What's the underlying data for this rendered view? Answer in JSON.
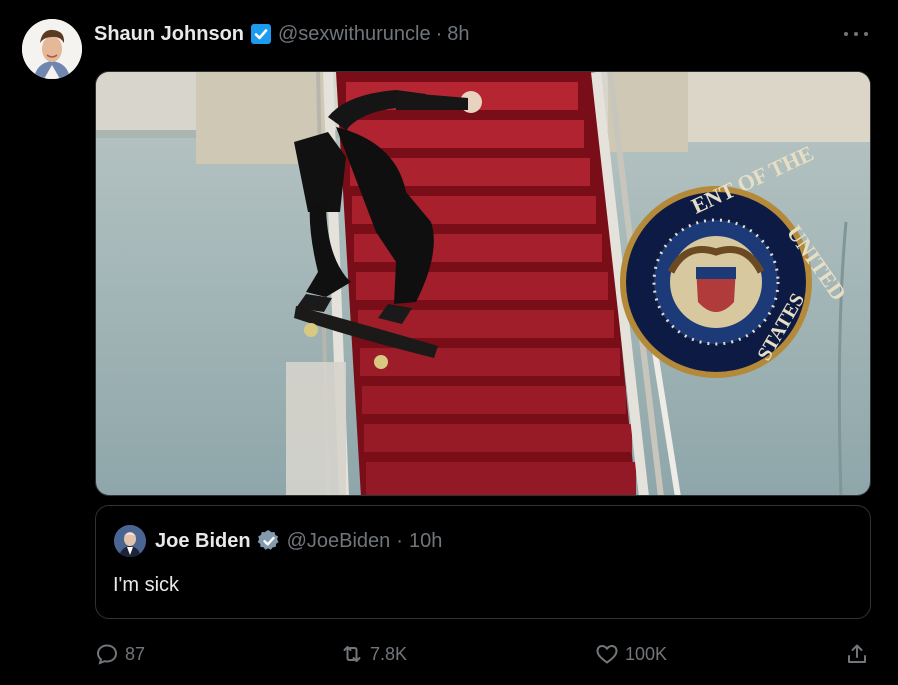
{
  "tweet": {
    "author_name": "Shaun Johnson",
    "handle": "@sexwithuruncle",
    "separator": "·",
    "time": "8h",
    "media": {
      "seal_text": "ENT OF THE UNITED STATES"
    }
  },
  "quoted": {
    "author_name": "Joe Biden",
    "handle": "@JoeBiden",
    "separator": "·",
    "time": "10h",
    "text": "I'm sick"
  },
  "actions": {
    "replies": "87",
    "reposts": "7.8K",
    "likes": "100K"
  },
  "colors": {
    "background": "#000000",
    "text": "#e7e9ea",
    "muted": "#71767b",
    "verified_blue": "#1d9bf0",
    "verified_gray": "#829aab"
  }
}
